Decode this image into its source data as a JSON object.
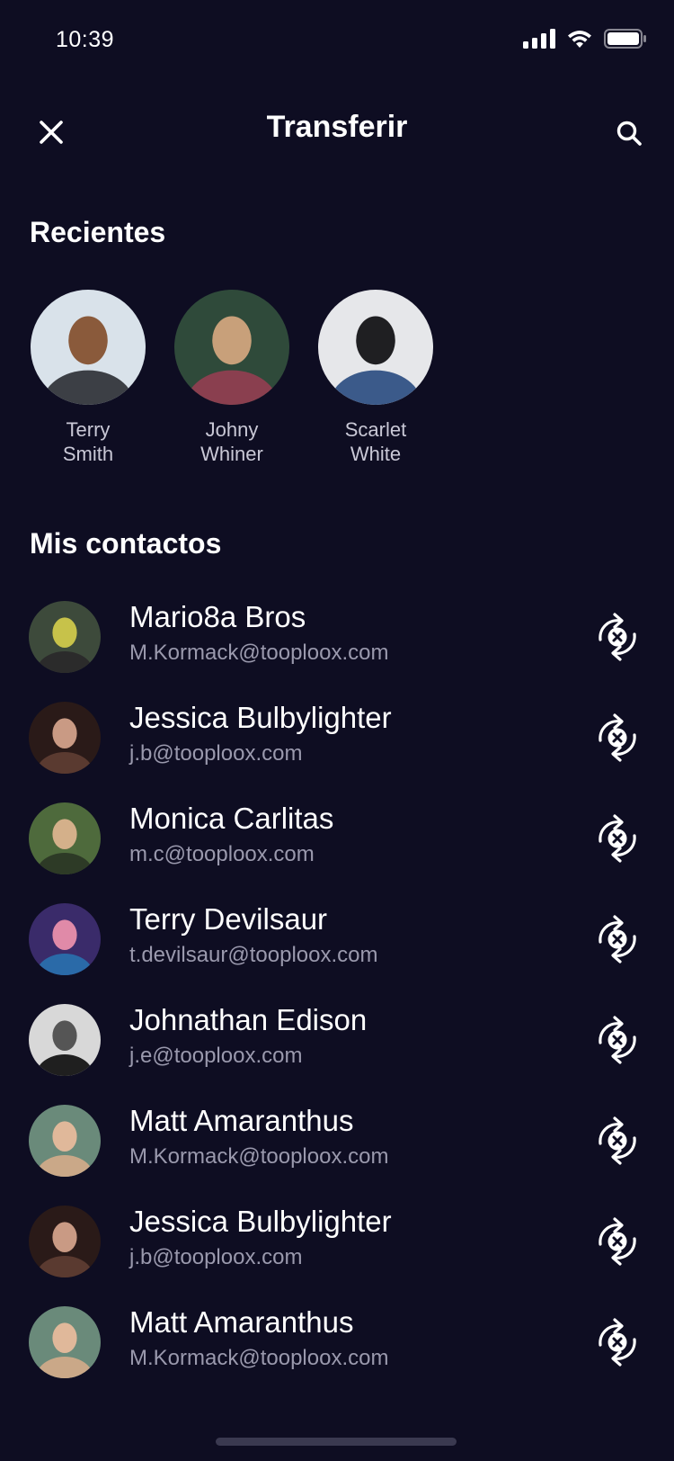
{
  "status_bar": {
    "time": "10:39"
  },
  "nav": {
    "title": "Transferir",
    "close_icon": "close-icon",
    "search_icon": "search-icon"
  },
  "recents": {
    "title": "Recientes",
    "items": [
      {
        "first": "Terry",
        "last": "Smith",
        "palette": [
          "#d9e2ea",
          "#8a5a3b",
          "#3c3f45"
        ]
      },
      {
        "first": "Johny",
        "last": "Whiner",
        "palette": [
          "#2f4a3a",
          "#c8a07a",
          "#8a3f4f"
        ]
      },
      {
        "first": "Scarlet",
        "last": "White",
        "palette": [
          "#e6e7ea",
          "#1f1f22",
          "#3b5a8a"
        ]
      }
    ]
  },
  "contacts": {
    "title": "Mis contactos",
    "items": [
      {
        "name": "Mario8a Bros",
        "email": "M.Kormack@tooploox.com",
        "palette": [
          "#3d4a3b",
          "#c7c24a",
          "#2b2b2b"
        ]
      },
      {
        "name": "Jessica Bulbylighter",
        "email": "j.b@tooploox.com",
        "palette": [
          "#2a1a18",
          "#c99a84",
          "#5a3a30"
        ]
      },
      {
        "name": "Monica Carlitas",
        "email": "m.c@tooploox.com",
        "palette": [
          "#4e6a3c",
          "#d4b08a",
          "#2d3a26"
        ]
      },
      {
        "name": "Terry Devilsaur",
        "email": "t.devilsaur@tooploox.com",
        "palette": [
          "#3a2b6a",
          "#e08aa8",
          "#2a6aa8"
        ]
      },
      {
        "name": "Johnathan Edison",
        "email": "j.e@tooploox.com",
        "palette": [
          "#d8d8d8",
          "#555555",
          "#1f1f1f"
        ]
      },
      {
        "name": "Matt Amaranthus",
        "email": "M.Kormack@tooploox.com",
        "palette": [
          "#6a8a7a",
          "#e0b89a",
          "#caa888"
        ]
      },
      {
        "name": "Jessica Bulbylighter",
        "email": "j.b@tooploox.com",
        "palette": [
          "#2a1a18",
          "#c99a84",
          "#5a3a30"
        ]
      },
      {
        "name": "Matt Amaranthus",
        "email": "M.Kormack@tooploox.com",
        "palette": [
          "#6a8a7a",
          "#e0b89a",
          "#caa888"
        ]
      }
    ],
    "action_icon": "transfer-cycle-icon"
  },
  "colors": {
    "background": "#0e0d22",
    "text_primary": "#ffffff",
    "text_secondary": "#9a99ad"
  }
}
